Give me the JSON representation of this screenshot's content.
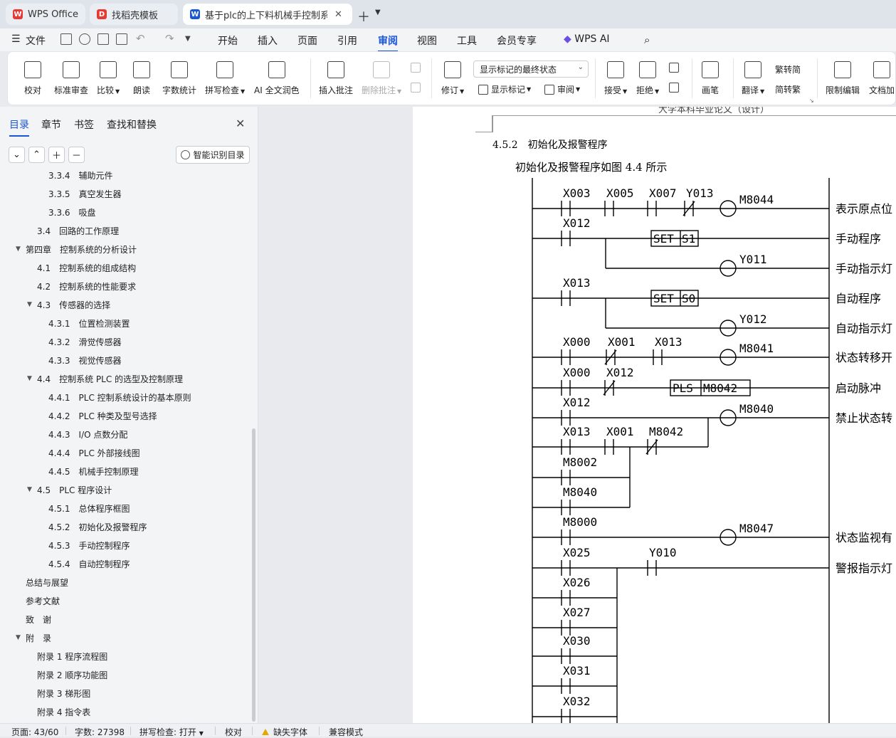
{
  "tabs": [
    {
      "label": "WPS Office",
      "icon": "wps-logo-icon",
      "color": "#e53935"
    },
    {
      "label": "找稻壳模板",
      "icon": "docer-icon",
      "color": "#e53935"
    },
    {
      "label": "基于plc的上下料机械手控制系",
      "icon": "writer-w-icon",
      "color": "#1a56db"
    }
  ],
  "menu": {
    "file": "文件",
    "items": [
      "开始",
      "插入",
      "页面",
      "引用",
      "审阅",
      "视图",
      "工具",
      "会员专享"
    ],
    "active": "审阅",
    "ai": "WPS AI"
  },
  "ribbon": {
    "buttons": [
      "校对",
      "标准审查",
      "比较",
      "朗读",
      "字数统计",
      "拼写检查",
      "AI 全文润色",
      "插入批注",
      "删除批注",
      "修订",
      "画笔",
      "限制编辑",
      "文档加"
    ],
    "markup_state": "显示标记的最终状态",
    "show_markup": "显示标记",
    "review": "审阅",
    "accept": "接受",
    "reject": "拒绝",
    "translate": "翻译",
    "trad": "繁转简",
    "simp": "简转繁",
    "trad_label": "转繁",
    "simp_label": "转简"
  },
  "panel": {
    "tabs": [
      "目录",
      "章节",
      "书签",
      "查找和替换"
    ],
    "smart_button": "智能识别目录",
    "toc": [
      {
        "text": "3.3.4　辅助元件",
        "level": 3,
        "toggle": ""
      },
      {
        "text": "3.3.5　真空发生器",
        "level": 3,
        "toggle": ""
      },
      {
        "text": "3.3.6　吸盘",
        "level": 3,
        "toggle": ""
      },
      {
        "text": "3.4　回路的工作原理",
        "level": 2,
        "toggle": ""
      },
      {
        "text": "第四章　控制系统的分析设计",
        "level": 1,
        "toggle": "▼"
      },
      {
        "text": "4.1　控制系统的组成结构",
        "level": 2,
        "toggle": ""
      },
      {
        "text": "4.2　控制系统的性能要求",
        "level": 2,
        "toggle": ""
      },
      {
        "text": "4.3　传感器的选择",
        "level": 2,
        "toggle": "▼"
      },
      {
        "text": "4.3.1　位置检测装置",
        "level": 3,
        "toggle": ""
      },
      {
        "text": "4.3.2　滑觉传感器",
        "level": 3,
        "toggle": ""
      },
      {
        "text": "4.3.3　视觉传感器",
        "level": 3,
        "toggle": ""
      },
      {
        "text": "4.4　控制系统 PLC 的选型及控制原理",
        "level": 2,
        "toggle": "▼"
      },
      {
        "text": "4.4.1　PLC 控制系统设计的基本原则",
        "level": 3,
        "toggle": ""
      },
      {
        "text": "4.4.2　PLC 种类及型号选择",
        "level": 3,
        "toggle": ""
      },
      {
        "text": "4.4.3　I/O 点数分配",
        "level": 3,
        "toggle": ""
      },
      {
        "text": "4.4.4　PLC 外部接线图",
        "level": 3,
        "toggle": ""
      },
      {
        "text": "4.4.5　机械手控制原理",
        "level": 3,
        "toggle": ""
      },
      {
        "text": "4.5　PLC 程序设计",
        "level": 2,
        "toggle": "▼"
      },
      {
        "text": "4.5.1　总体程序框图",
        "level": 3,
        "toggle": ""
      },
      {
        "text": "4.5.2　初始化及报警程序",
        "level": 3,
        "toggle": ""
      },
      {
        "text": "4.5.3　手动控制程序",
        "level": 3,
        "toggle": ""
      },
      {
        "text": "4.5.4　自动控制程序",
        "level": 3,
        "toggle": ""
      },
      {
        "text": "总结与展望",
        "level": 1,
        "toggle": ""
      },
      {
        "text": "参考文献",
        "level": 1,
        "toggle": ""
      },
      {
        "text": "致　谢",
        "level": 1,
        "toggle": ""
      },
      {
        "text": "附　录",
        "level": 1,
        "toggle": "▼"
      },
      {
        "text": "附录 1  程序流程图",
        "level": 2,
        "toggle": ""
      },
      {
        "text": "附录 2  顺序功能图",
        "level": 2,
        "toggle": ""
      },
      {
        "text": "附录 3  梯形图",
        "level": 2,
        "toggle": ""
      },
      {
        "text": "附录 4  指令表",
        "level": 2,
        "toggle": ""
      }
    ]
  },
  "document": {
    "header": "大学本科毕业论文（设计）",
    "heading": "4.5.2　初始化及报警程序",
    "caption": "初始化及报警程序如图 4.4 所示",
    "ladder": {
      "contacts": [
        "X003",
        "X005",
        "X007",
        "Y013",
        "X012",
        "X013",
        "X000",
        "X001",
        "X013",
        "X000",
        "X012",
        "X012",
        "X013",
        "X001",
        "M8042",
        "M8002",
        "M8040",
        "M8000",
        "X025",
        "Y010",
        "X026",
        "X027",
        "X030",
        "X031",
        "X032"
      ],
      "coils": [
        "M8044",
        "Y011",
        "Y012",
        "M8041",
        "M8040",
        "M8047"
      ],
      "instructions": [
        "SET",
        "S1",
        "SET",
        "S0",
        "PLS",
        "M8042"
      ],
      "comments": [
        "表示原点位",
        "手动程序",
        "手动指示灯",
        "自动程序",
        "自动指示灯",
        "状态转移开",
        "启动脉冲",
        "禁止状态转",
        "状态监视有",
        "警报指示灯"
      ]
    }
  },
  "status": {
    "page": "页面: 43/60",
    "words": "字数: 27398",
    "spell": "拼写检查: 打开",
    "proof": "校对",
    "missing_font": "缺失字体",
    "compat": "兼容模式"
  }
}
